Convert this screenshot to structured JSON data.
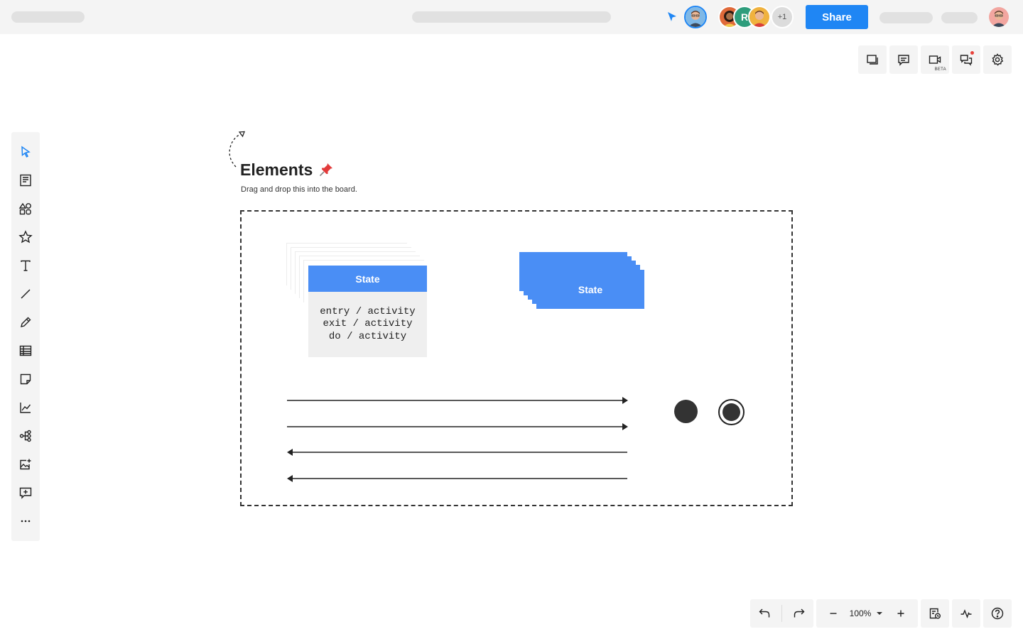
{
  "topbar": {
    "share_label": "Share",
    "extra_collaborators": "+1",
    "collaborator_initial": "R"
  },
  "canvas": {
    "title": "Elements",
    "subtitle": "Drag and drop this into the board.",
    "state_card": {
      "label": "State",
      "lines": [
        "entry / activity",
        "exit / activity",
        "do / activity"
      ]
    },
    "composite_state": {
      "label": "State"
    }
  },
  "bottom_toolbar": {
    "zoom": "100%"
  },
  "icons": {
    "sidebar": [
      "select-icon",
      "template-icon",
      "shapes-icon",
      "star-icon",
      "text-icon",
      "line-icon",
      "pen-icon",
      "table-icon",
      "sticky-note-icon",
      "chart-icon",
      "mindmap-icon",
      "image-icon",
      "comment-add-icon",
      "more-icon"
    ],
    "top_right": [
      "frames-icon",
      "comments-icon",
      "video-icon",
      "chat-icon",
      "settings-icon"
    ],
    "bottom": [
      "undo-icon",
      "redo-icon",
      "zoom-out-icon",
      "zoom-in-icon",
      "history-icon",
      "activity-icon",
      "help-icon"
    ]
  },
  "colors": {
    "accent": "#1f86f4",
    "state_blue": "#4a8ef5",
    "toolbar_bg": "#f4f4f4",
    "notification": "#e8413a"
  },
  "labels": {
    "beta": "BETA"
  }
}
